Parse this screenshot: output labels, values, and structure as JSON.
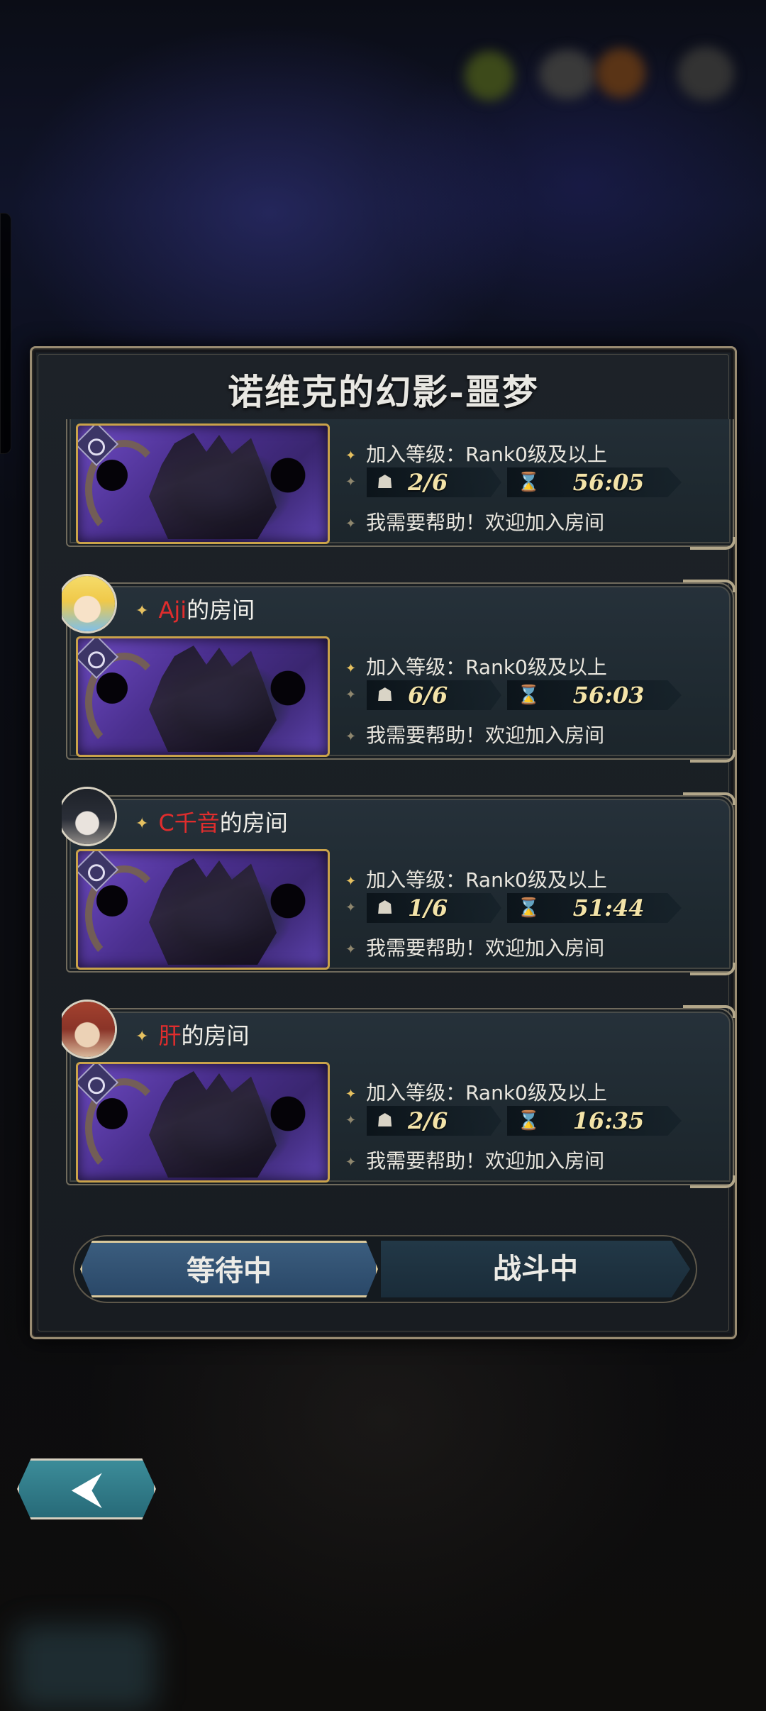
{
  "dialog": {
    "title": "诺维克的幻影-噩梦"
  },
  "rooms": [
    {
      "host": "",
      "suffix": "",
      "level_req": "加入等级：Rank0级及以上",
      "players": "2/6",
      "time": "56:05",
      "message": "我需要帮助！欢迎加入房间",
      "avatar_colors": [
        "#555",
        "#333"
      ]
    },
    {
      "host": "Aji",
      "suffix": "的房间",
      "level_req": "加入等级：Rank0级及以上",
      "players": "6/6",
      "time": "56:03",
      "message": "我需要帮助！欢迎加入房间",
      "avatar_colors": [
        "#f5dc6a",
        "#7fc0e8"
      ]
    },
    {
      "host": "C千音",
      "suffix": "的房间",
      "level_req": "加入等级：Rank0级及以上",
      "players": "1/6",
      "time": "51:44",
      "message": "我需要帮助！欢迎加入房间",
      "avatar_colors": [
        "#2b2f38",
        "#c9c5c2"
      ]
    },
    {
      "host": "肝",
      "suffix": "的房间",
      "level_req": "加入等级：Rank0级及以上",
      "players": "2/6",
      "time": "16:35",
      "message": "我需要帮助！欢迎加入房间",
      "avatar_colors": [
        "#8a3428",
        "#e8c9a8"
      ]
    }
  ],
  "tabs": {
    "waiting": "等待中",
    "fighting": "战斗中",
    "selected": "waiting"
  },
  "icons": {
    "players": "players-icon",
    "timer": "hourglass-icon",
    "back": "back-arrow-icon"
  },
  "colors": {
    "host_name": "#e02d2d",
    "value_text": "#f3e3a8",
    "frame_gold": "#9a8c72",
    "tab_selected": "#3b5d7e"
  }
}
